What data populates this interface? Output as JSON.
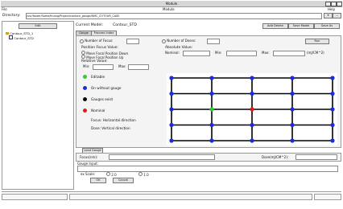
{
  "window": {
    "title": "Module"
  },
  "menu": {
    "file": "File",
    "help": "Help",
    "sub": "Module"
  },
  "directory": {
    "label": "Directory:",
    "value": "/usr/foster/Some/Knnng/Project/contour_gauge/NMC_COTOUR_CASE"
  },
  "tree": {
    "header": "Edit",
    "items": [
      {
        "label": "Contour_STD_1"
      },
      {
        "label": "Contour_STD"
      }
    ]
  },
  "current_model": {
    "label": "Current Model:",
    "value": "Contour_STD"
  },
  "top_buttons": {
    "add_delete": "Add Delete",
    "save_model": "Save Model",
    "save_as": "Save As"
  },
  "tabs": {
    "gauge": "Gauge",
    "process_index": "Process Index"
  },
  "focus_controls": {
    "number_of_focus_label": "Number of Focus:",
    "number_of_focus_value": "",
    "number_of_doses_label": "Number of Doses:",
    "number_of_doses_value": "",
    "run_label": "Run",
    "position_focus_value_label": "Position Focus Value:",
    "move_down": "Move Focal Position Down",
    "move_up": "Move Focal Position Up",
    "relative_value_label": "Relative Value:",
    "min_label": "Min:",
    "min_value": "",
    "max_label": "Max:",
    "max_value": "",
    "absolute_value_label": "Absolute Value:",
    "nominal_label": "Nominal:",
    "nominal_value": "",
    "abs_min_label": "Min:",
    "abs_min_value": "",
    "abs_max_label": "Max:",
    "abs_max_value": "",
    "units": "(mJ/CM^2)"
  },
  "legend": {
    "editable": "Editable",
    "on_without_gauge": "On without gauge",
    "gauges_exist": "Gauges exist",
    "nominal": "Nominal",
    "focus_text": "Focus: Horizontal direction",
    "dose_text": "Dose: Vertical direction",
    "colors": {
      "editable": "#2ecc2e",
      "on_without_gauge": "#1a2be0",
      "gauges_exist": "#0a0a0a",
      "nominal": "#e01a1a"
    }
  },
  "grid": {
    "cols": 5,
    "rows": 5,
    "nominal": [
      2,
      2
    ],
    "editable": [
      1,
      2
    ]
  },
  "load_gauge": {
    "label": "Load Gauge"
  },
  "focus_dose": {
    "focus_label": "Focus(nm):",
    "focus_value": "",
    "dose_label": "Dose(mJ/CM^2):",
    "dose_value": ""
  },
  "gauge_input": {
    "label": "Gauge Input:",
    "value": "",
    "scale_label": "ex Scale:",
    "scale_a": "2.0",
    "scale_b": "1.0",
    "ok": "OK",
    "cancel": "Cancel"
  }
}
